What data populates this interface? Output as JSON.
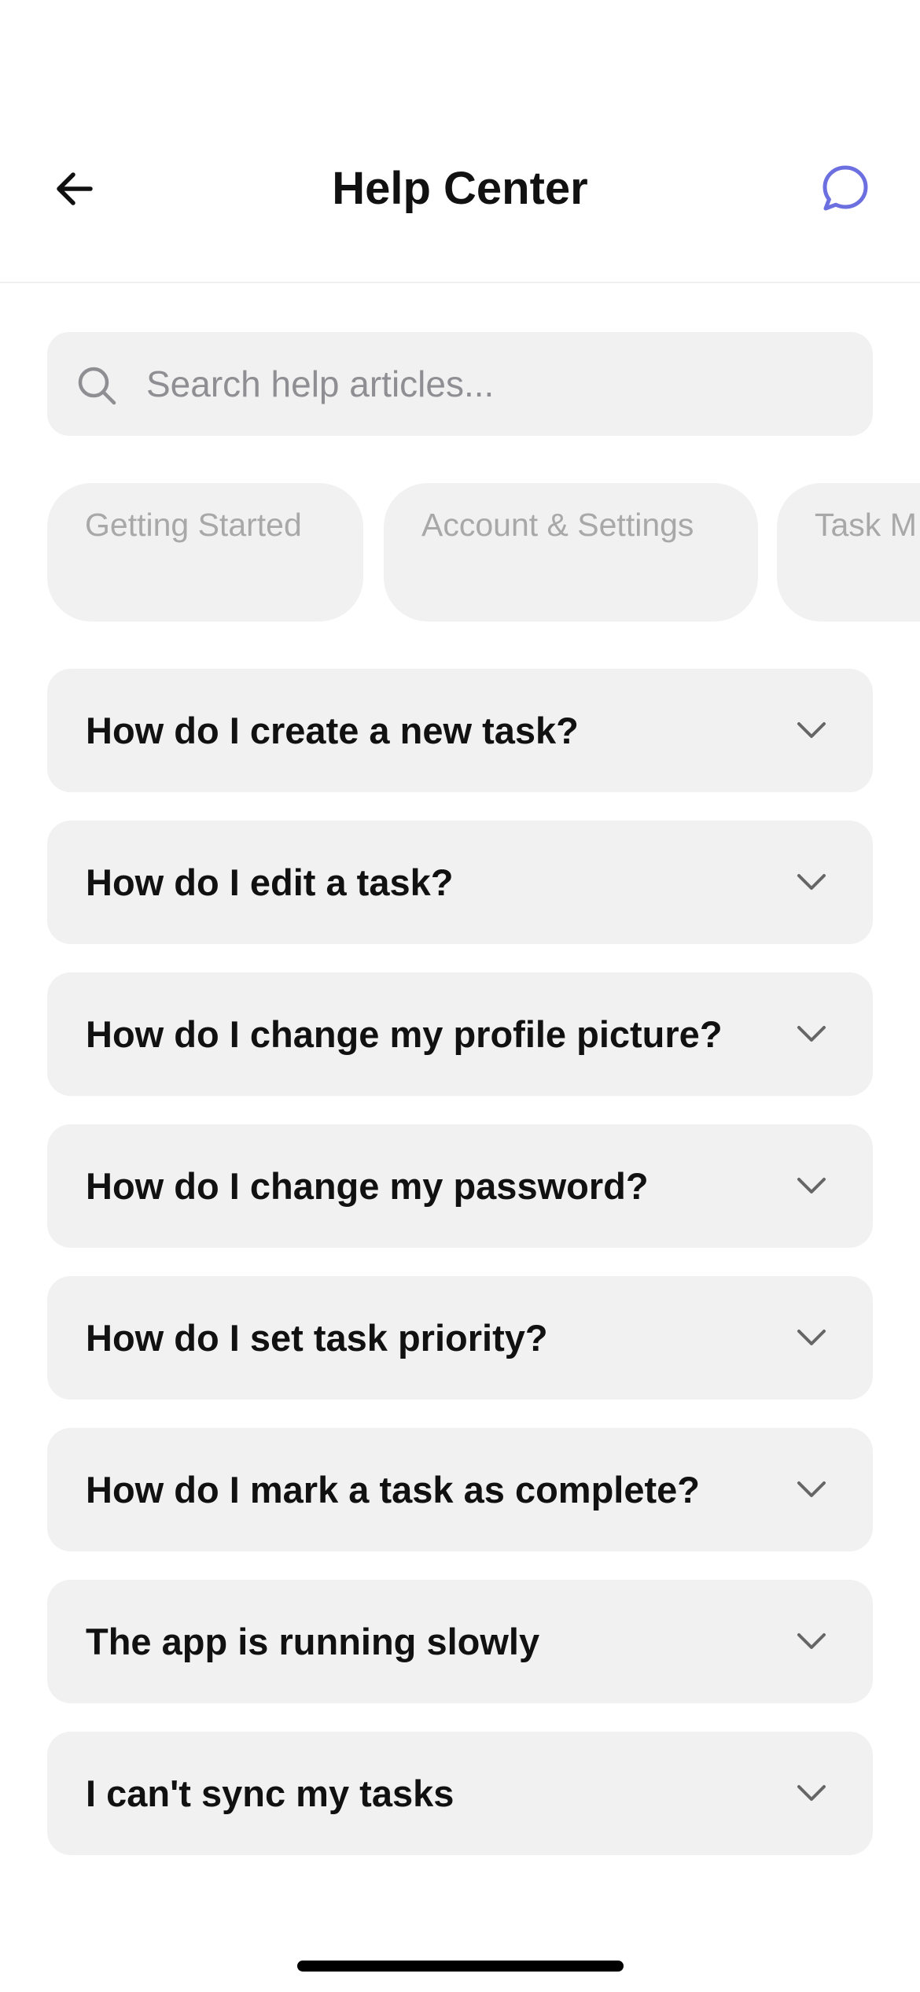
{
  "header": {
    "title": "Help Center",
    "back_icon": "arrow-left-icon",
    "chat_icon": "chat-bubble-icon",
    "accent_color": "#6c6fe0"
  },
  "search": {
    "placeholder": "Search help articles...",
    "value": "",
    "icon": "search-icon"
  },
  "categories": [
    {
      "label": "Getting Started"
    },
    {
      "label": "Account & Settings"
    },
    {
      "label": "Task M"
    }
  ],
  "faqs": [
    {
      "question": "How do I create a new task?"
    },
    {
      "question": "How do I edit a task?"
    },
    {
      "question": "How do I change my profile picture?"
    },
    {
      "question": "How do I change my password?"
    },
    {
      "question": "How do I set task priority?"
    },
    {
      "question": "How do I mark a task as complete?"
    },
    {
      "question": "The app is running slowly"
    },
    {
      "question": "I can't sync my tasks"
    }
  ]
}
